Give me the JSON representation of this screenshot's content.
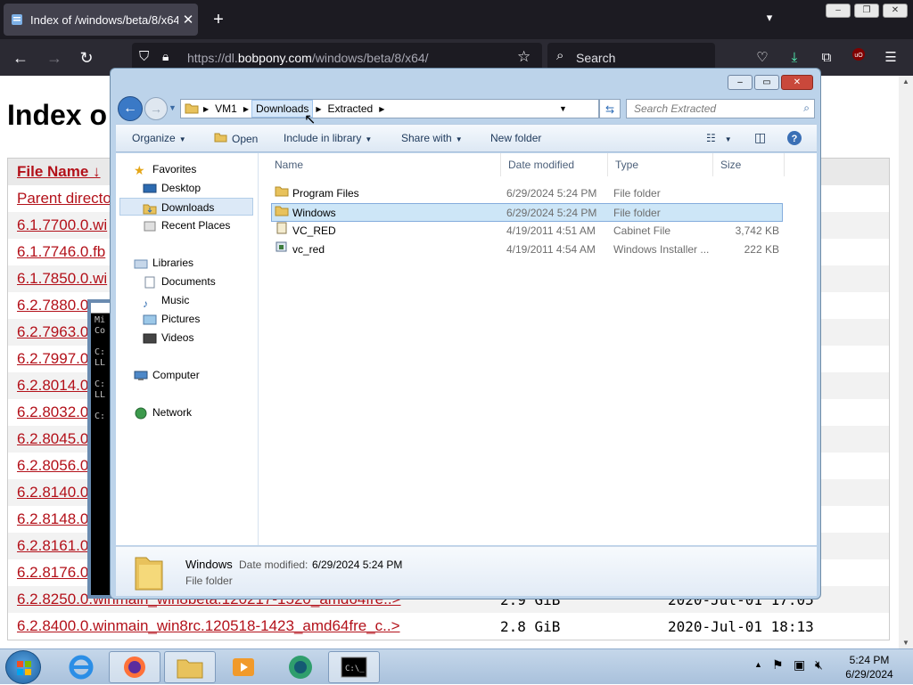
{
  "firefox": {
    "tab_title": "Index of /windows/beta/8/x64/",
    "tab_close": "✕",
    "new_tab": "+",
    "url_prefix": "https://dl.",
    "url_domain": "bobpony.com",
    "url_path": "/windows/beta/8/x64/",
    "search_placeholder": "Search",
    "window_controls": [
      "–",
      "❐",
      "✕"
    ]
  },
  "page": {
    "heading": "Index o",
    "header_col": "File Name  ↓",
    "rows": [
      {
        "name": "Parent directo",
        "size": "",
        "date": ""
      },
      {
        "name": "6.1.7700.0.wi",
        "size": "",
        "date": ""
      },
      {
        "name": "6.1.7746.0.fb",
        "size": "",
        "date": ""
      },
      {
        "name": "6.1.7850.0.wi",
        "size": "",
        "date": ""
      },
      {
        "name": "6.2.7880.0",
        "size": "",
        "date": ""
      },
      {
        "name": "6.2.7963.0",
        "size": "",
        "date": ""
      },
      {
        "name": "6.2.7997.0",
        "size": "",
        "date": ""
      },
      {
        "name": "6.2.8014.0",
        "size": "",
        "date": ""
      },
      {
        "name": "6.2.8032.0",
        "size": "",
        "date": ""
      },
      {
        "name": "6.2.8045.0",
        "size": "",
        "date": ""
      },
      {
        "name": "6.2.8056.0",
        "size": "",
        "date": ""
      },
      {
        "name": "6.2.8140.0",
        "size": "",
        "date": ""
      },
      {
        "name": "6.2.8148.0",
        "size": "",
        "date": ""
      },
      {
        "name": "6.2.8161.0",
        "size": "",
        "date": ""
      },
      {
        "name": "6.2.8176.0",
        "size": "",
        "date": ""
      },
      {
        "name": "6.2.8250.0.winmain_win8beta.120217-1520_amd64fre..>",
        "size": "2.9 GiB",
        "date": "2020-Jul-01 17:05"
      },
      {
        "name": "6.2.8400.0.winmain_win8rc.120518-1423_amd64fre_c..>",
        "size": "2.8 GiB",
        "date": "2020-Jul-01 18:13"
      }
    ]
  },
  "cmd_text": "Mi\nCo\n\nC:\nLL\n\nC:\nLL\n\nC:",
  "explorer": {
    "breadcrumb": [
      "VM1",
      "Downloads",
      "Extracted"
    ],
    "search_placeholder": "Search Extracted",
    "toolbar": {
      "organize": "Organize",
      "open": "Open",
      "include": "Include in library",
      "share": "Share with",
      "new_folder": "New folder"
    },
    "nav": {
      "favorites": "Favorites",
      "desktop": "Desktop",
      "downloads": "Downloads",
      "recent": "Recent Places",
      "libraries": "Libraries",
      "documents": "Documents",
      "music": "Music",
      "pictures": "Pictures",
      "videos": "Videos",
      "computer": "Computer",
      "network": "Network"
    },
    "columns": {
      "name": "Name",
      "date": "Date modified",
      "type": "Type",
      "size": "Size"
    },
    "files": [
      {
        "name": "Program Files",
        "date": "6/29/2024 5:24 PM",
        "type": "File folder",
        "size": ""
      },
      {
        "name": "Windows",
        "date": "6/29/2024 5:24 PM",
        "type": "File folder",
        "size": ""
      },
      {
        "name": "VC_RED",
        "date": "4/19/2011 4:51 AM",
        "type": "Cabinet File",
        "size": "3,742 KB"
      },
      {
        "name": "vc_red",
        "date": "4/19/2011 4:54 AM",
        "type": "Windows Installer ...",
        "size": "222 KB"
      }
    ],
    "details": {
      "name": "Windows",
      "date_label": "Date modified:",
      "date_value": "6/29/2024 5:24 PM",
      "type": "File folder"
    }
  },
  "taskbar": {
    "time": "5:24 PM",
    "date": "6/29/2024"
  }
}
